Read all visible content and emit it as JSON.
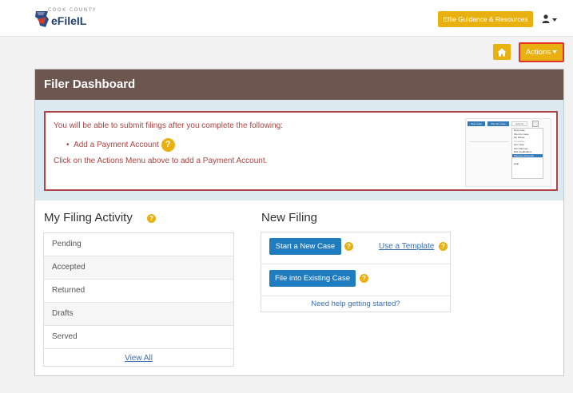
{
  "header": {
    "logo_small": "COOK COUNTY",
    "logo_main": "eFileIL",
    "guidance_button": "Efile Guidance & Resources",
    "user_icon": "user-icon"
  },
  "toolbar": {
    "home_icon": "home-icon",
    "actions_label": "Actions"
  },
  "dashboard": {
    "title": "Filer Dashboard",
    "notice": {
      "line1": "You will be able to submit filings after you complete the following:",
      "bullet": "Add a Payment Account",
      "line3": "Click on the Actions Menu above to add a Payment Account."
    },
    "thumbnail": {
      "buttons": [
        "New Case",
        "File Into Case"
      ],
      "actions": "Actions",
      "menu_items": [
        "New Case",
        "File Into Case",
        "My Filings",
        "Templates",
        "Firm User",
        "Firm Attorney",
        "Edit Cardholders",
        "Payment Accounts",
        "Help"
      ]
    },
    "activity": {
      "title": "My Filing Activity",
      "items": [
        "Pending",
        "Accepted",
        "Returned",
        "Drafts",
        "Served"
      ],
      "view_all": "View All"
    },
    "new_filing": {
      "title": "New Filing",
      "start_button": "Start a New Case",
      "template_link": "Use a Template",
      "existing_button": "File into Existing Case",
      "help_link": "Need help getting started?"
    }
  },
  "colors": {
    "header_bar": "#6e5650",
    "accent_gold": "#e9b10f",
    "primary_blue": "#1f7cbf",
    "notice_red": "#a94442"
  }
}
